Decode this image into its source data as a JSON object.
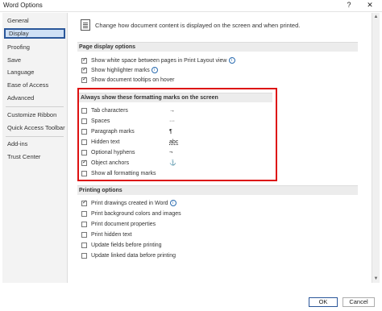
{
  "window": {
    "title": "Word Options",
    "help_label": "?",
    "close_label": "✕"
  },
  "sidebar": {
    "items": [
      {
        "label": "General"
      },
      {
        "label": "Display"
      },
      {
        "label": "Proofing"
      },
      {
        "label": "Save"
      },
      {
        "label": "Language"
      },
      {
        "label": "Ease of Access"
      },
      {
        "label": "Advanced"
      },
      {
        "label": "Customize Ribbon"
      },
      {
        "label": "Quick Access Toolbar"
      },
      {
        "label": "Add-ins"
      },
      {
        "label": "Trust Center"
      }
    ],
    "selected": "Display"
  },
  "intro": {
    "text": "Change how document content is displayed on the screen and when printed."
  },
  "page_display": {
    "header": "Page display options",
    "options": [
      {
        "label": "Show white space between pages in Print Layout view",
        "checked": true,
        "info": true
      },
      {
        "label": "Show highlighter marks",
        "checked": true,
        "info": true
      },
      {
        "label": "Show document tooltips on hover",
        "checked": true,
        "info": false
      }
    ]
  },
  "formatting_marks": {
    "header": "Always show these formatting marks on the screen",
    "options": [
      {
        "label": "Tab characters",
        "checked": false,
        "symbol": "→"
      },
      {
        "label": "Spaces",
        "checked": false,
        "symbol": "···"
      },
      {
        "label": "Paragraph marks",
        "checked": false,
        "symbol": "¶"
      },
      {
        "label": "Hidden text",
        "checked": false,
        "symbol": "abc"
      },
      {
        "label": "Optional hyphens",
        "checked": false,
        "symbol": "¬"
      },
      {
        "label": "Object anchors",
        "checked": true,
        "symbol": "⚓"
      },
      {
        "label": "Show all formatting marks",
        "checked": false,
        "symbol": ""
      }
    ]
  },
  "printing": {
    "header": "Printing options",
    "options": [
      {
        "label": "Print drawings created in Word",
        "checked": true,
        "info": true
      },
      {
        "label": "Print background colors and images",
        "checked": false,
        "info": false
      },
      {
        "label": "Print document properties",
        "checked": false,
        "info": false
      },
      {
        "label": "Print hidden text",
        "checked": false,
        "info": false
      },
      {
        "label": "Update fields before printing",
        "checked": false,
        "info": false
      },
      {
        "label": "Update linked data before printing",
        "checked": false,
        "info": false
      }
    ]
  },
  "footer": {
    "ok_label": "OK",
    "cancel_label": "Cancel"
  },
  "colors": {
    "accent": "#2b579a",
    "highlight_box": "#dd1111",
    "selected_bg": "#cfe0f5"
  }
}
